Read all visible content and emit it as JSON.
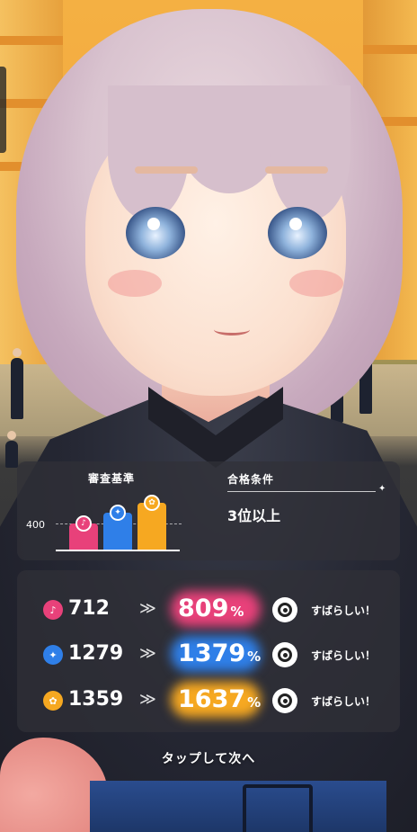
{
  "criteria": {
    "title": "審査基準",
    "axis_label": "400",
    "bars": [
      {
        "name": "vocal",
        "icon": "microphone-icon",
        "glyph": "♪",
        "color": "#e8417a",
        "level": 0.55
      },
      {
        "name": "dance",
        "icon": "dance-icon",
        "glyph": "✦",
        "color": "#2f7fe8",
        "level": 0.78
      },
      {
        "name": "visual",
        "icon": "visual-icon",
        "glyph": "✿",
        "color": "#f6a821",
        "level": 1.0
      }
    ]
  },
  "pass_condition": {
    "title": "合格条件",
    "value": "3位以上"
  },
  "results": [
    {
      "stat": "vocal",
      "icon": "microphone-icon",
      "glyph": "♪",
      "color": "#e8417a",
      "value": "712",
      "arrow": "≫",
      "percent": "809",
      "percent_sign": "%",
      "verdict": "すばらしい！"
    },
    {
      "stat": "dance",
      "icon": "dance-icon",
      "glyph": "✦",
      "color": "#2f7fe8",
      "value": "1279",
      "arrow": "≫",
      "percent": "1379",
      "percent_sign": "%",
      "verdict": "すばらしい！"
    },
    {
      "stat": "visual",
      "icon": "visual-icon",
      "glyph": "✿",
      "color": "#f6a821",
      "value": "1359",
      "arrow": "≫",
      "percent": "1637",
      "percent_sign": "%",
      "verdict": "すばらしい！"
    }
  ],
  "tap_prompt": "タップして次へ"
}
